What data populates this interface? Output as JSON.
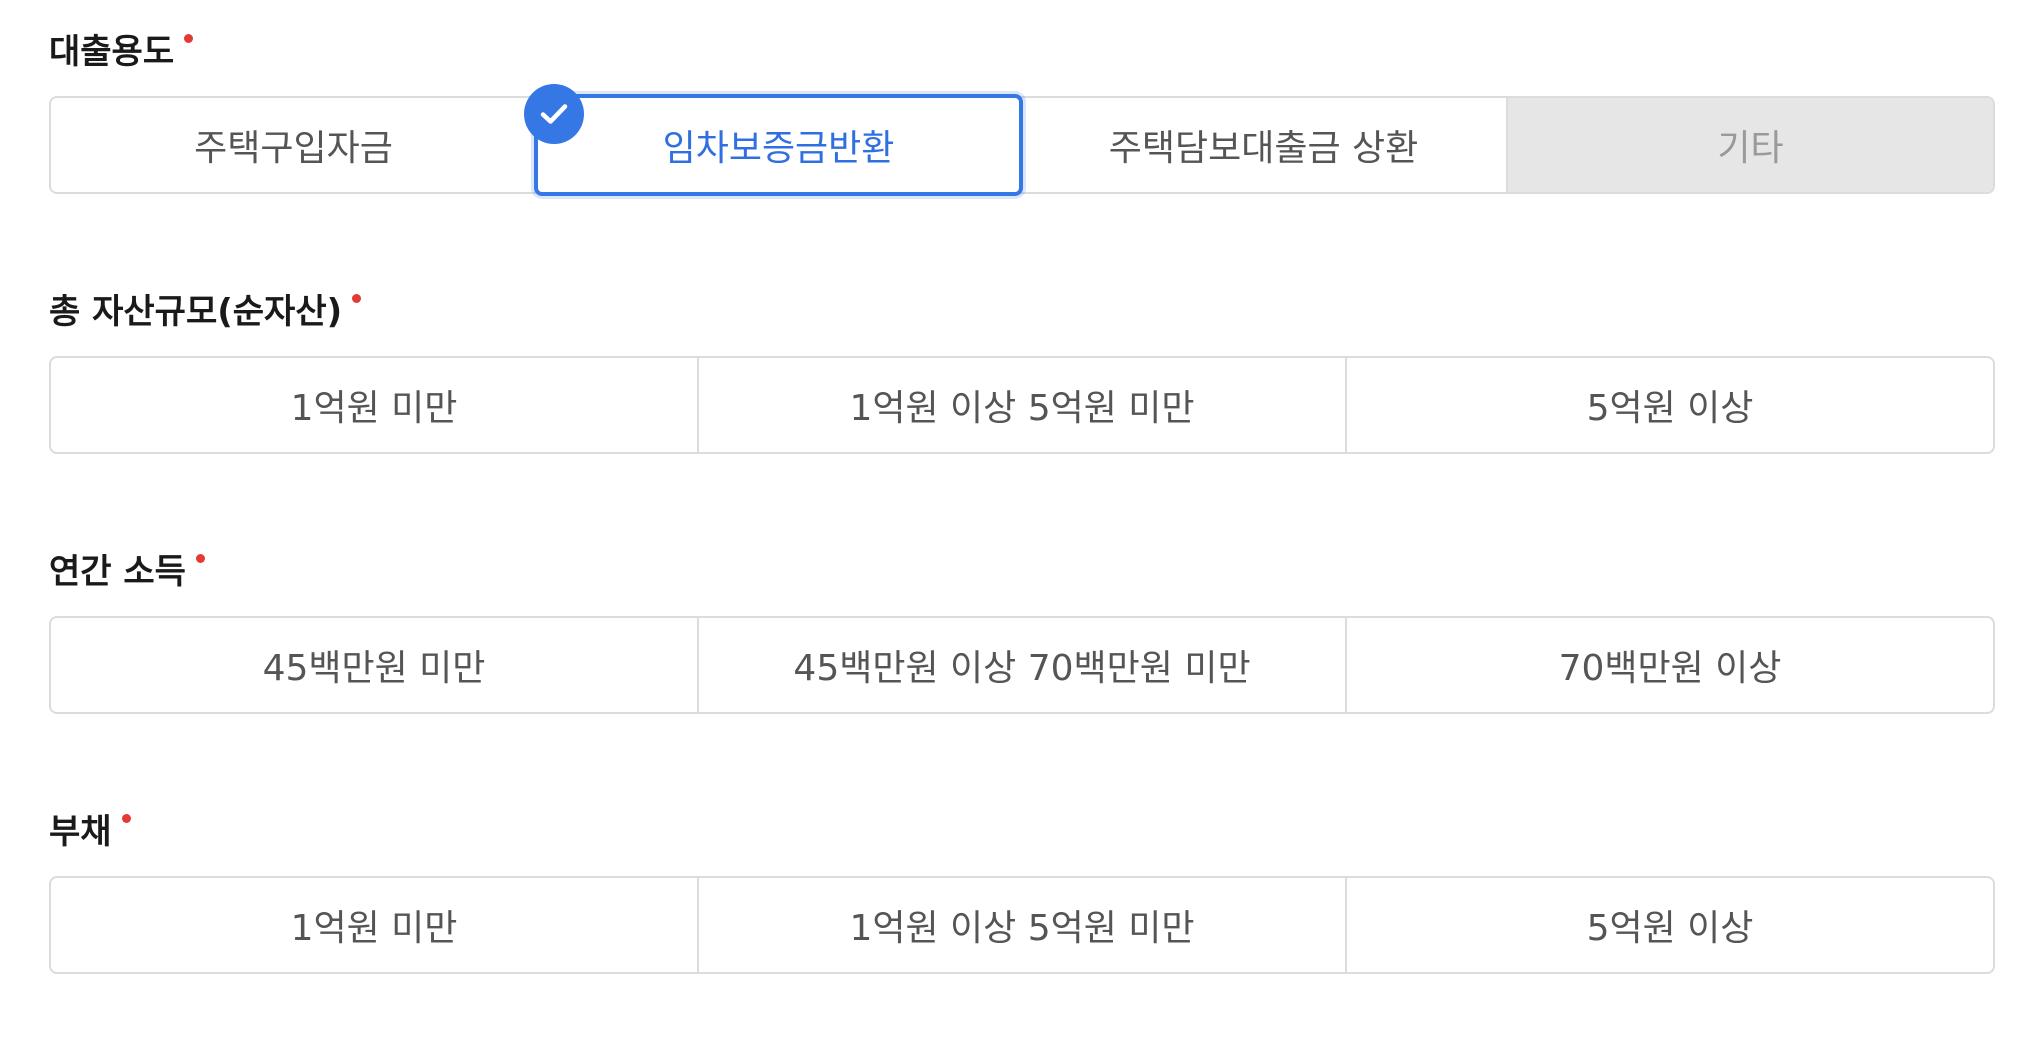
{
  "colors": {
    "accent": "#3577e5",
    "required": "#e53935",
    "disabled_bg": "#e6e6e6",
    "border": "#dcdcdc"
  },
  "sections": [
    {
      "label": "대출용도",
      "required": true,
      "options": [
        "주택구입자금",
        "임차보증금반환",
        "주택담보대출금 상환",
        "기타"
      ],
      "selected_index": 1,
      "disabled_index": 3
    },
    {
      "label": "총 자산규모(순자산)",
      "required": true,
      "options": [
        "1억원 미만",
        "1억원 이상 5억원 미만",
        "5억원 이상"
      ]
    },
    {
      "label": "연간 소득",
      "required": true,
      "options": [
        "45백만원 미만",
        "45백만원 이상 70백만원 미만",
        "70백만원 이상"
      ]
    },
    {
      "label": "부채",
      "required": true,
      "options": [
        "1억원 미만",
        "1억원 이상 5억원 미만",
        "5억원 이상"
      ]
    }
  ],
  "icons": {
    "selected_check": "check-icon",
    "required_marker": "required-dot"
  }
}
